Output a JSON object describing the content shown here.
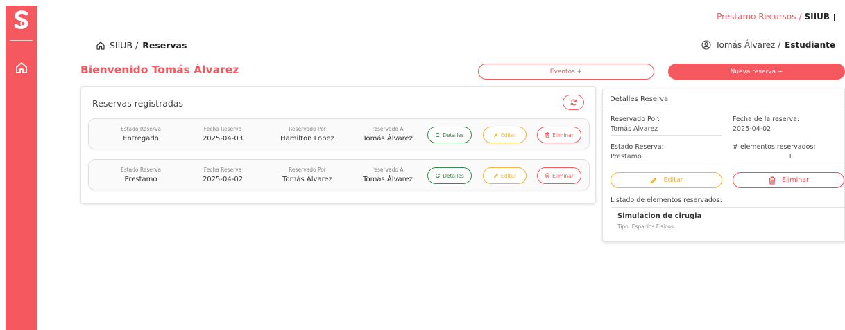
{
  "colors": {
    "accent": "#f5595f",
    "green": "#3a8a4f",
    "yellow": "#f2b43c"
  },
  "header": {
    "app_name": "Prestamo Recursos",
    "separator": "/",
    "root": "SIIUB"
  },
  "breadcrumb": {
    "root": "SIIUB /",
    "current": "Reservas"
  },
  "user": {
    "name": "Tomás Álvarez /",
    "role": "Estudiante"
  },
  "welcome": "Bienvenido Tomás Álvarez",
  "actions": {
    "eventos": "Eventos +",
    "nueva_reserva": "Nueva reserva +"
  },
  "reservas": {
    "title": "Reservas registradas",
    "labels": {
      "estado": "Estado Reserva",
      "fecha": "Fecha Reserva",
      "por": "Reservado Por",
      "a": "reservado A"
    },
    "buttons": {
      "detalles": "Detalles",
      "editar": "Editar",
      "eliminar": "Eliminar"
    },
    "rows": [
      {
        "estado": "Entregado",
        "fecha": "2025-04-03",
        "por": "Hamilton Lopez",
        "a": "Tomás Álvarez"
      },
      {
        "estado": "Prestamo",
        "fecha": "2025-04-02",
        "por": "Tomás Álvarez",
        "a": "Tomás Álvarez"
      }
    ]
  },
  "detalle": {
    "title": "Detalles Reserva",
    "reservado_por_label": "Reservado Por:",
    "reservado_por": "Tomás Álvarez",
    "fecha_label": "Fecha de la reserva:",
    "fecha": "2025-04-02",
    "estado_label": "Estado Reserva:",
    "estado": "Prestamo",
    "elementos_label": "# elementos reservados:",
    "elementos": "1",
    "editar": "Editar",
    "eliminar": "Eliminar",
    "listado_label": "Listado de elementos reservados:",
    "items": [
      {
        "name": "Simulacion de cirugia",
        "type": "Tipo: Espacios Físicos"
      }
    ]
  }
}
